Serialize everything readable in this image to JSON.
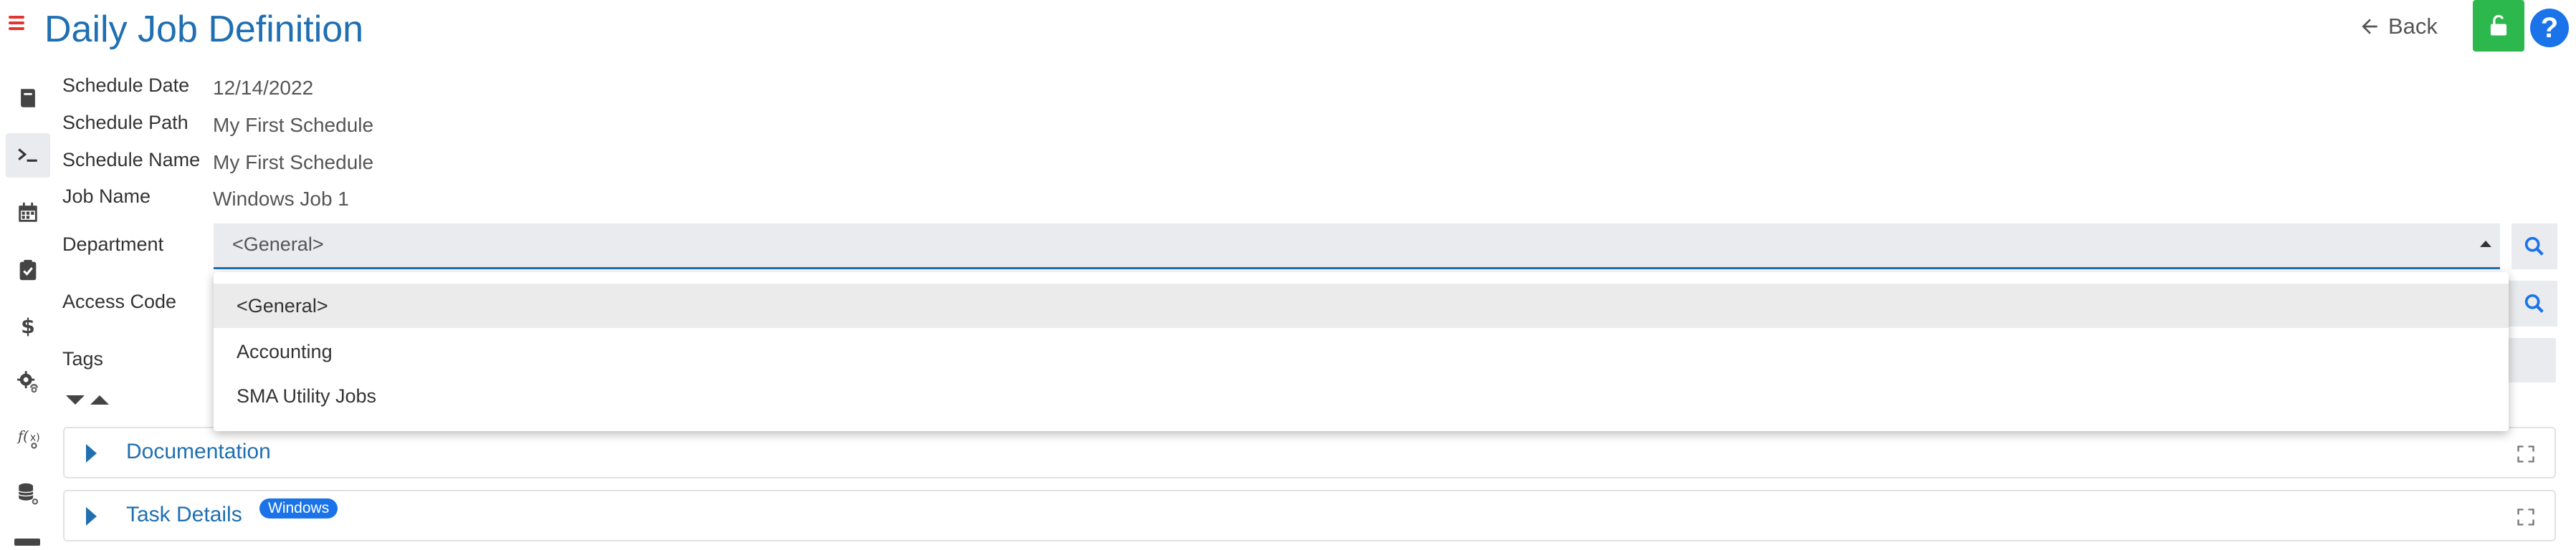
{
  "header": {
    "title": "Daily Job Definition",
    "back_label": "Back",
    "help_label": "?"
  },
  "sidebar": {
    "items": [
      {
        "icon": "book-icon"
      },
      {
        "icon": "terminal-icon",
        "active": true
      },
      {
        "icon": "calendar-icon"
      },
      {
        "icon": "clipboard-check-icon"
      },
      {
        "icon": "dollar-icon"
      },
      {
        "icon": "gear-link-icon"
      },
      {
        "icon": "function-link-icon"
      },
      {
        "icon": "database-link-icon"
      }
    ]
  },
  "form": {
    "schedule_date_label": "Schedule Date",
    "schedule_date_value": "12/14/2022",
    "schedule_path_label": "Schedule Path",
    "schedule_path_value": "My First Schedule",
    "schedule_name_label": "Schedule Name",
    "schedule_name_value": "My First Schedule",
    "job_name_label": "Job Name",
    "job_name_value": "Windows Job 1",
    "department_label": "Department",
    "department_value": "<General>",
    "access_code_label": "Access Code",
    "tags_label": "Tags"
  },
  "dropdown": {
    "options": [
      "<General>",
      "Accounting",
      "SMA Utility Jobs"
    ],
    "selected": "<General>"
  },
  "sections": [
    {
      "title": "Documentation"
    },
    {
      "title": "Task Details",
      "badge": "Windows"
    }
  ],
  "colors": {
    "title": "#1f6fb2",
    "accent": "#1a73e8",
    "lock_button": "#2db84d",
    "menu_icon": "#e3342f"
  }
}
